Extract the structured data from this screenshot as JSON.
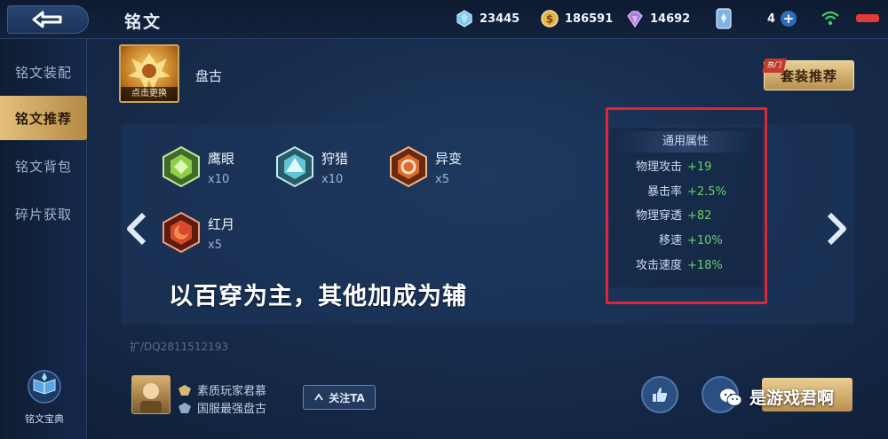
{
  "header": {
    "title": "铭文",
    "currencies": [
      {
        "icon": "diamond-icon",
        "value": "23445"
      },
      {
        "icon": "gold-coin-icon",
        "value": "186591"
      },
      {
        "icon": "crystal-icon",
        "value": "14692"
      },
      {
        "icon": "card-icon",
        "value": "4"
      }
    ]
  },
  "sidebar": {
    "items": [
      {
        "label": "铭文装配"
      },
      {
        "label": "铭文推荐"
      },
      {
        "label": "铭文背包"
      },
      {
        "label": "碎片获取"
      }
    ],
    "active_index": 1,
    "codex_label": "铭文宝典"
  },
  "hero": {
    "change_label": "点击更换",
    "name": "盘古"
  },
  "suit_button": {
    "badge": "热门",
    "label": "套装推荐"
  },
  "inscriptions": [
    {
      "name": "鹰眼",
      "count": "x10",
      "color": "#8fcf4a"
    },
    {
      "name": "狩猎",
      "count": "x10",
      "color": "#63c4d6"
    },
    {
      "name": "异变",
      "count": "x5",
      "color": "#e06a2a"
    },
    {
      "name": "红月",
      "count": "x5",
      "color": "#d8482c"
    }
  ],
  "stats": {
    "title": "通用属性",
    "rows": [
      {
        "key": "物理攻击",
        "value": "+19"
      },
      {
        "key": "暴击率",
        "value": "+2.5%"
      },
      {
        "key": "物理穿透",
        "value": "+82"
      },
      {
        "key": "移速",
        "value": "+10%"
      },
      {
        "key": "攻击速度",
        "value": "+18%"
      }
    ]
  },
  "caption": "以百穿为主，其他加成为辅",
  "code": "扩/DQ2811512193",
  "author": {
    "name": "素质玩家君慕",
    "title": "国服最强盘古"
  },
  "follow_label": "关注TA",
  "watermark": "是游戏君啊",
  "colors": {
    "accent": "#e02634",
    "gold": "#d9b875",
    "stat_green": "#67d16a"
  }
}
